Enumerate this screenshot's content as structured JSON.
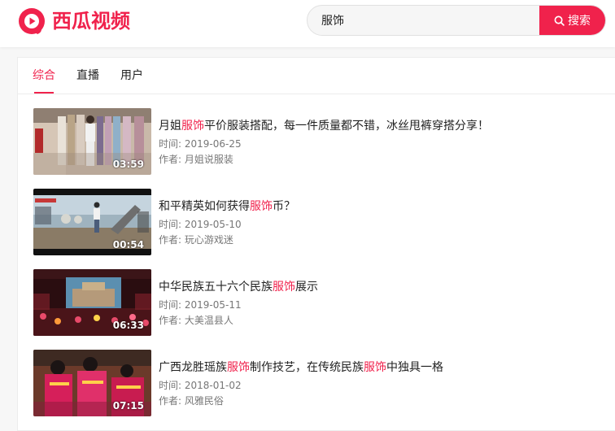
{
  "brand": {
    "name": "西瓜视频",
    "logo_icon": "xigua-logo-icon",
    "accent_color": "#f0224c"
  },
  "search": {
    "value": "服饰",
    "button_label": "搜索",
    "icon": "search-icon"
  },
  "tabs": [
    {
      "label": "综合",
      "active": true
    },
    {
      "label": "直播",
      "active": false
    },
    {
      "label": "用户",
      "active": false
    }
  ],
  "meta_labels": {
    "time": "时间: ",
    "author": "作者: "
  },
  "videos": [
    {
      "title_parts": [
        "月姐",
        "服饰",
        "平价服装搭配，每一件质量都不错，冰丝甩裤穿搭分享！"
      ],
      "duration": "03:59",
      "date": "2019-06-25",
      "author": "月姐说服装"
    },
    {
      "title_parts": [
        "和平精英如何获得",
        "服饰",
        "币？"
      ],
      "duration": "00:54",
      "date": "2019-05-10",
      "author": "玩心游戏迷"
    },
    {
      "title_parts": [
        "中华民族五十六个民族",
        "服饰",
        "展示"
      ],
      "duration": "06:33",
      "date": "2019-05-11",
      "author": "大美温县人"
    },
    {
      "title_parts": [
        "广西龙胜瑶族",
        "服饰",
        "制作技艺，在传统民族",
        "服饰",
        "中独具一格"
      ],
      "duration": "07:15",
      "date": "2018-01-02",
      "author": "风雅民俗"
    }
  ]
}
